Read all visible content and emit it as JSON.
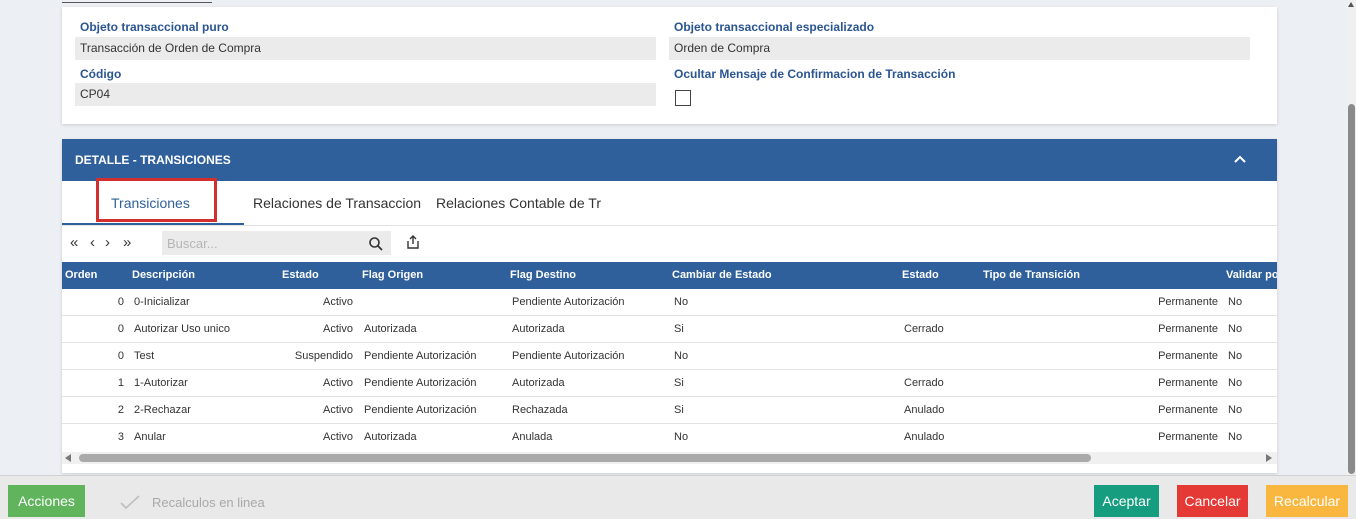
{
  "form": {
    "pure_label": "Objeto transaccional puro",
    "pure_value": "Transacción de Orden de Compra",
    "special_label": "Objeto transaccional especializado",
    "special_value": "Orden de Compra",
    "code_label": "Código",
    "code_value": "CP04",
    "hide_msg_label": "Ocultar Mensaje de Confirmacion de Transacción",
    "hide_msg_checked": false
  },
  "detail": {
    "title": "DETALLE - TRANSICIONES",
    "collapse_icon": "chevron-up-icon",
    "tabs": [
      {
        "label": "Transiciones",
        "active": true
      },
      {
        "label": "Relaciones de Transaccion",
        "active": false
      },
      {
        "label": "Relaciones Contable de Tr",
        "active": false
      }
    ],
    "toolbar": {
      "first_label": "«",
      "prev_label": "‹",
      "next_label": "›",
      "last_label": "»",
      "search_placeholder": "Buscar...",
      "search_icon": "search-icon",
      "export_icon": "export-icon"
    },
    "columns": [
      "Orden",
      "Descripción",
      "Estado",
      "Flag Origen",
      "Flag Destino",
      "Cambiar de Estado",
      "Estado",
      "Tipo de Transición",
      "Validar por"
    ],
    "rows": [
      {
        "orden": "0",
        "descripcion": "0-Inicializar",
        "estado": "Activo",
        "flag_origen": "",
        "flag_destino": "Pendiente Autorización",
        "cambiar": "No",
        "estado2": "",
        "tipo": "Permanente",
        "validar": "No"
      },
      {
        "orden": "0",
        "descripcion": "Autorizar Uso unico",
        "estado": "Activo",
        "flag_origen": "Autorizada",
        "flag_destino": "Autorizada",
        "cambiar": "Si",
        "estado2": "Cerrado",
        "tipo": "Permanente",
        "validar": "No"
      },
      {
        "orden": "0",
        "descripcion": "Test",
        "estado": "Suspendido",
        "flag_origen": "Pendiente Autorización",
        "flag_destino": "Pendiente Autorización",
        "cambiar": "No",
        "estado2": "",
        "tipo": "Permanente",
        "validar": "No"
      },
      {
        "orden": "1",
        "descripcion": "1-Autorizar",
        "estado": "Activo",
        "flag_origen": "Pendiente Autorización",
        "flag_destino": "Autorizada",
        "cambiar": "Si",
        "estado2": "Cerrado",
        "tipo": "Permanente",
        "validar": "No"
      },
      {
        "orden": "2",
        "descripcion": "2-Rechazar",
        "estado": "Activo",
        "flag_origen": "Pendiente Autorización",
        "flag_destino": "Rechazada",
        "cambiar": "Si",
        "estado2": "Anulado",
        "tipo": "Permanente",
        "validar": "No"
      },
      {
        "orden": "3",
        "descripcion": "Anular",
        "estado": "Activo",
        "flag_origen": "Autorizada",
        "flag_destino": "Anulada",
        "cambiar": "No",
        "estado2": "Anulado",
        "tipo": "Permanente",
        "validar": "No"
      }
    ]
  },
  "bottom": {
    "acciones_label": "Acciones",
    "recalc_label": "Recalculos en linea",
    "aceptar_label": "Aceptar",
    "cancelar_label": "Cancelar",
    "recalcular_label": "Recalcular"
  },
  "colors": {
    "primary": "#2f609b",
    "label_blue": "#2a5591",
    "acciones": "#5fb45c",
    "aceptar": "#169c7e",
    "cancelar": "#e53935",
    "recalcular": "#f9b740",
    "highlight": "#d32f2f"
  }
}
